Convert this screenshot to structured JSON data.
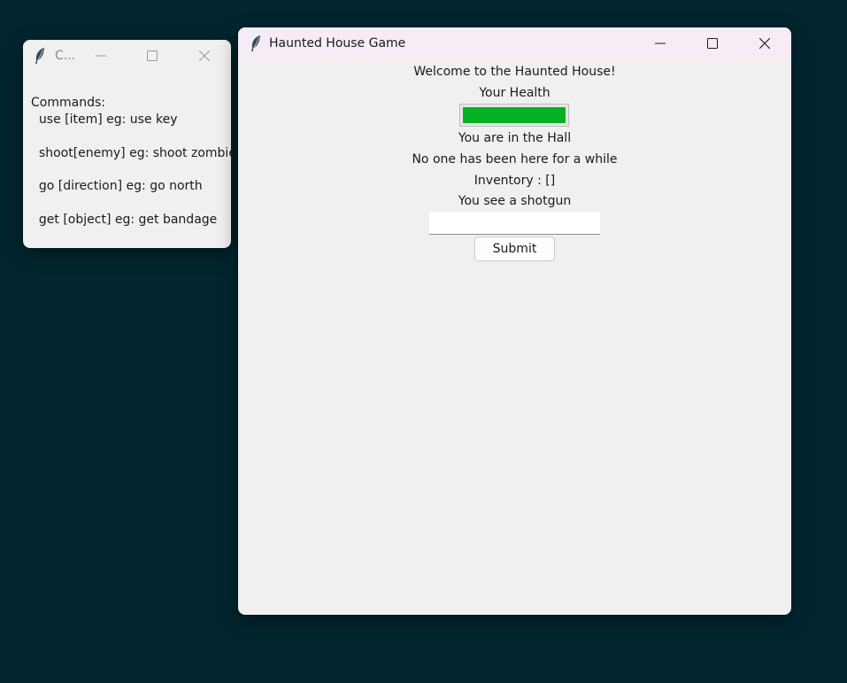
{
  "commands_window": {
    "title": "C...",
    "lines": [
      "Commands:",
      "  use [item] eg: use key",
      "  shoot[enemy] eg: shoot zombie",
      "  go [direction] eg: go north",
      "  get [object] eg: get bandage"
    ]
  },
  "game_window": {
    "title": "Haunted House Game",
    "welcome": "Welcome to the Haunted House!",
    "health_label": "Your Health",
    "health_level": 1.0,
    "location": "You are in the Hall",
    "description": "No one has been here for a while",
    "inventory": "Inventory : []",
    "item_seen": "You see a shotgun",
    "input_value": "",
    "submit_label": "Submit"
  },
  "colors": {
    "desktop_background": "#022630",
    "health_bar": "#06b025"
  },
  "icons": {
    "app_icon": "feather-icon",
    "minimize": "minimize-icon",
    "maximize": "maximize-icon",
    "close": "close-icon"
  }
}
